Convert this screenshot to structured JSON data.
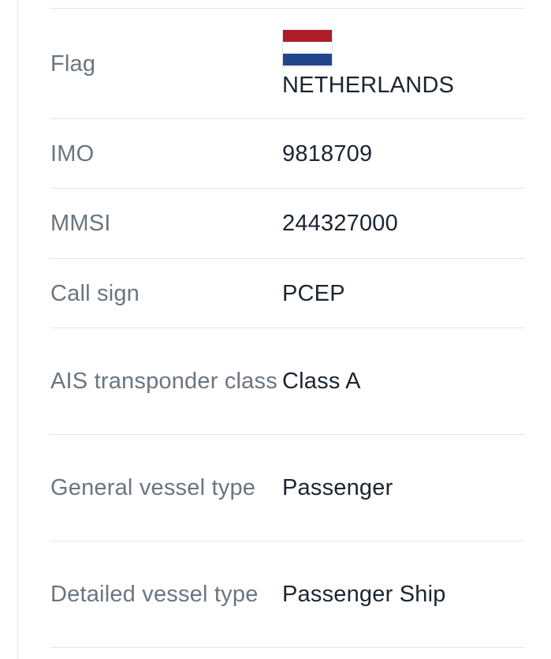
{
  "flag": {
    "country": "NETHERLANDS",
    "icon": "netherlands-flag-icon",
    "colors": [
      "#ae1c28",
      "#ffffff",
      "#21468b"
    ]
  },
  "rows": [
    {
      "label": "Flag",
      "value": "NETHERLANDS"
    },
    {
      "label": "IMO",
      "value": "9818709"
    },
    {
      "label": "MMSI",
      "value": "244327000"
    },
    {
      "label": "Call sign",
      "value": "PCEP"
    },
    {
      "label": "AIS transponder class",
      "value": "Class A"
    },
    {
      "label": "General vessel type",
      "value": "Passenger"
    },
    {
      "label": "Detailed vessel type",
      "value": "Passenger Ship"
    }
  ],
  "colors": {
    "label": "#6b7580",
    "value": "#1b2530",
    "divider": "#e3e6e9"
  }
}
